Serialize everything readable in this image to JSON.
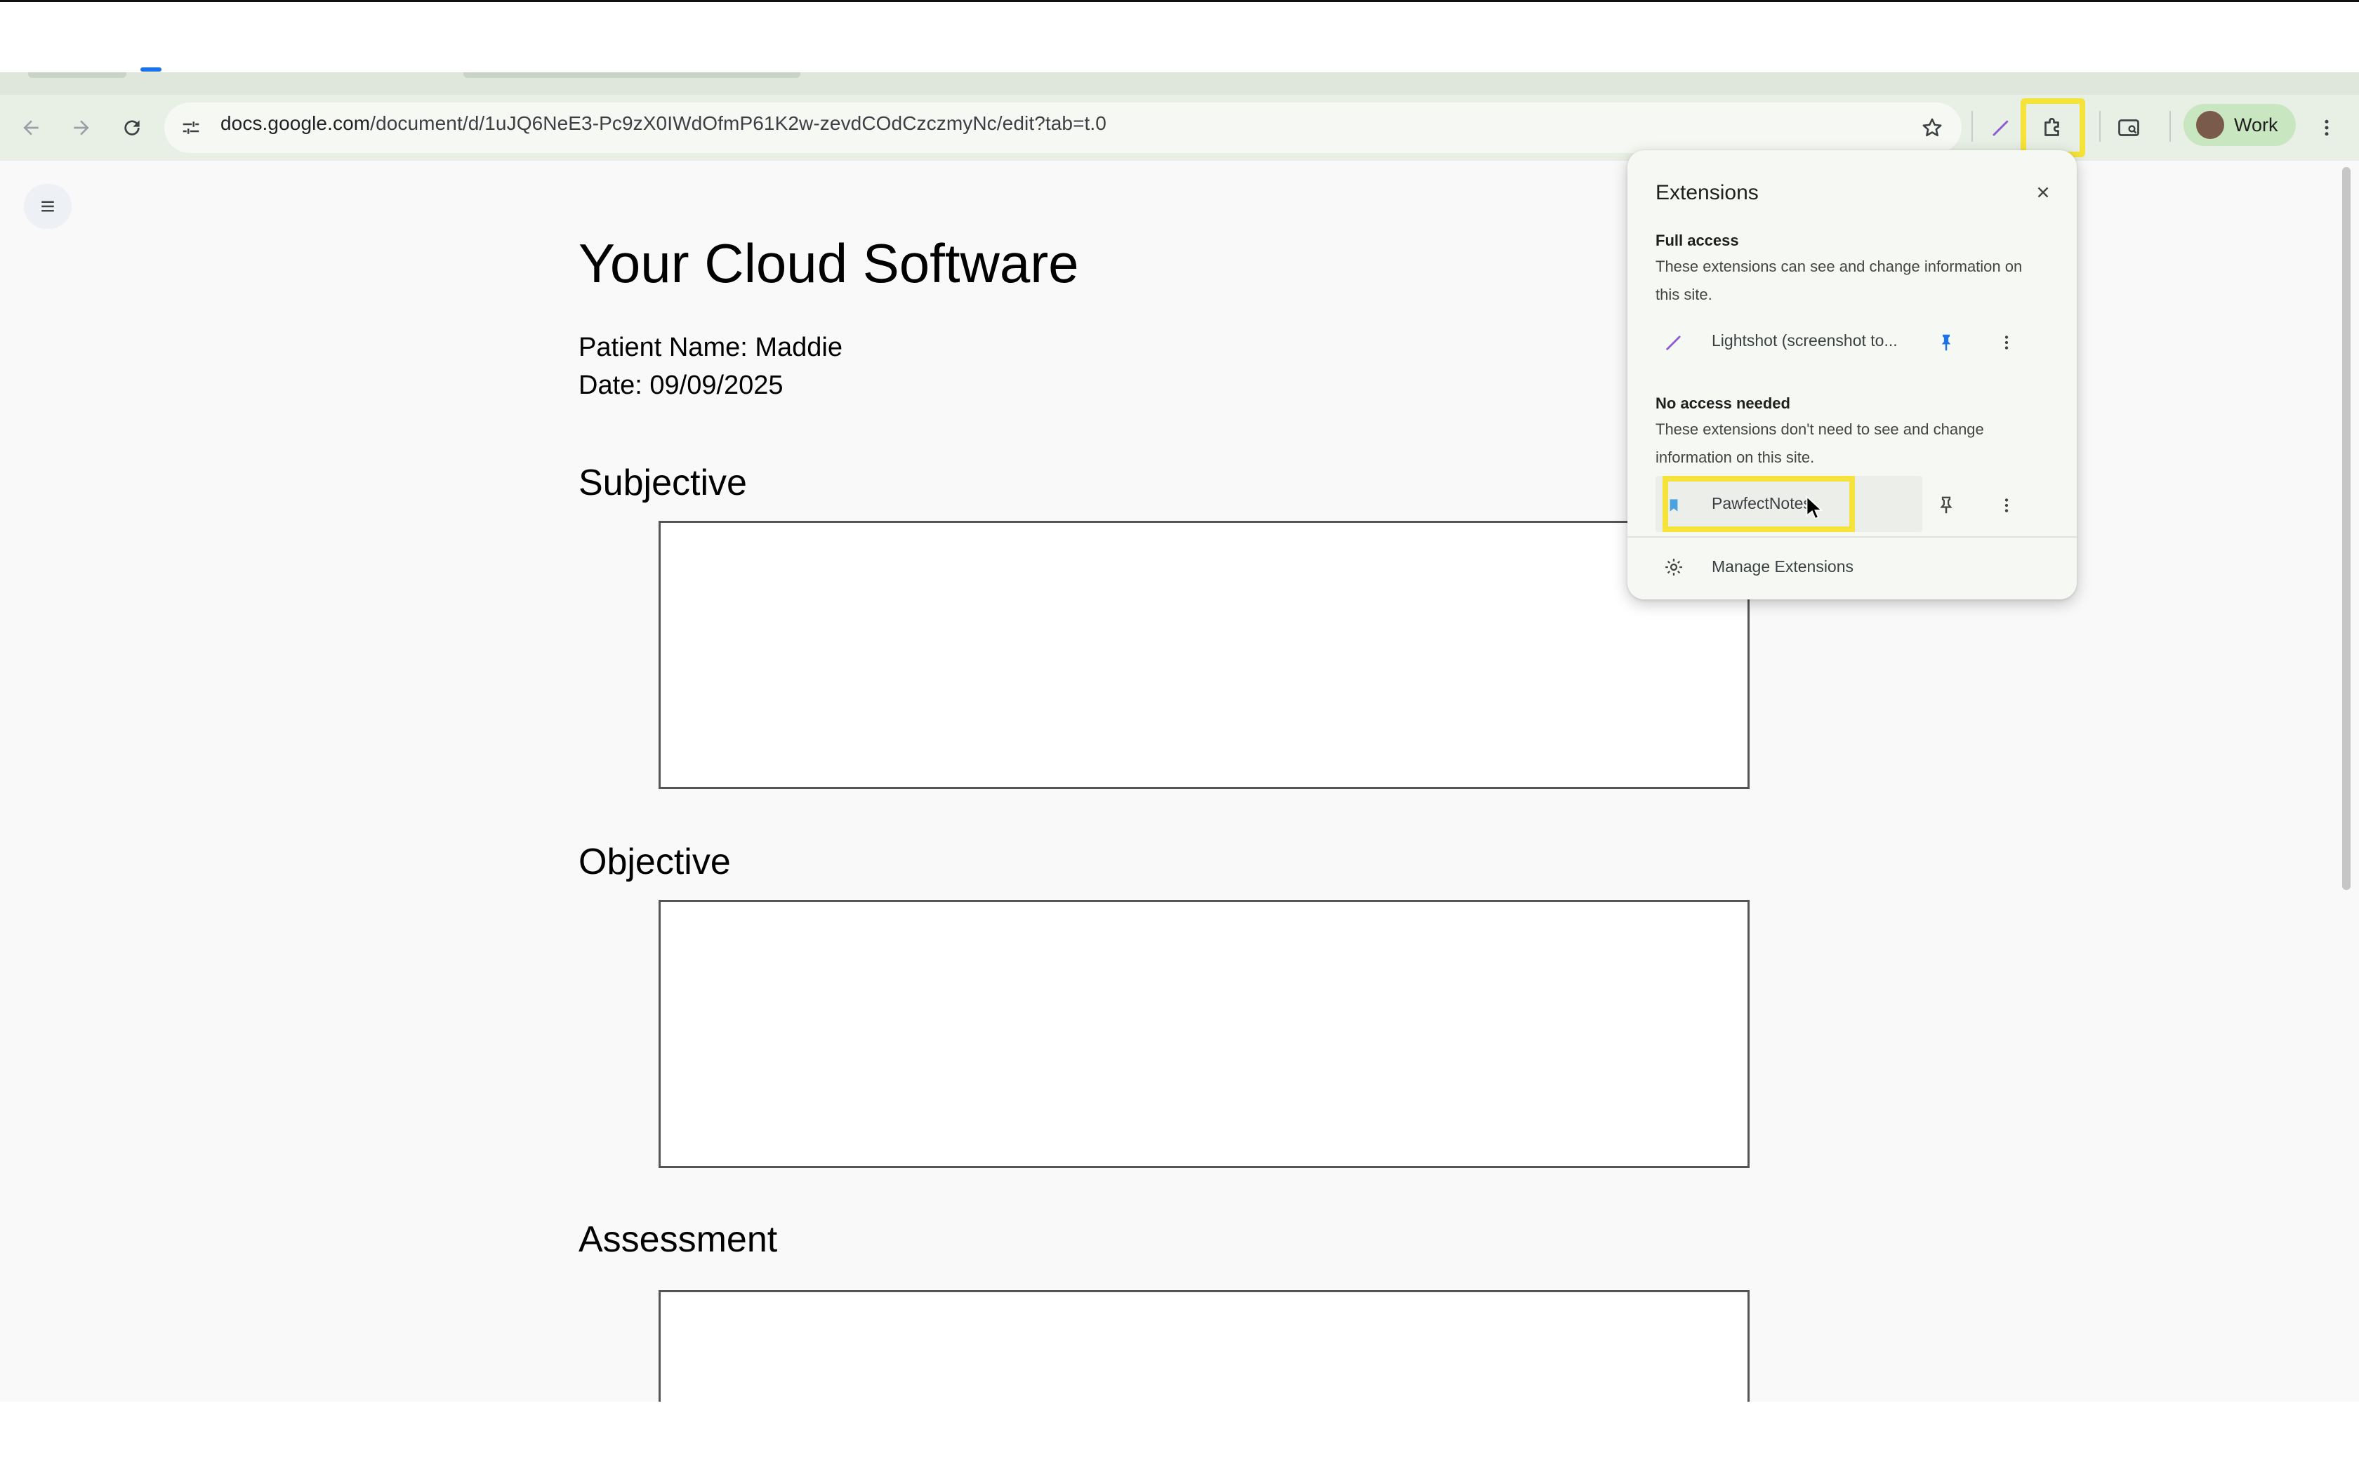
{
  "browser": {
    "url_host": "docs.google.com",
    "url_path": "/document/d/1uJQ6NeE3-Pc9zX0IWdOfmP61K2w-zevdCOdCzczmyNc/edit?tab=t.0",
    "profile_label": "Work",
    "icons": {
      "back": "arrow-left-icon",
      "forward": "arrow-right-icon",
      "reload": "reload-icon",
      "site_info": "tune-icon",
      "bookmark": "star-icon",
      "lightshot": "feather-icon",
      "extensions": "puzzle-icon",
      "tab_search": "tab-search-icon",
      "menu": "kebab-icon"
    },
    "highlight_color": "#f5e33b"
  },
  "document": {
    "title": "Your Cloud Software",
    "patient_name": "Patient Name: Maddie",
    "date": "Date: 09/09/2025",
    "sections": [
      {
        "heading": "Subjective"
      },
      {
        "heading": "Objective"
      },
      {
        "heading": "Assessment"
      }
    ]
  },
  "extensions_popup": {
    "title": "Extensions",
    "full_access": {
      "title": "Full access",
      "description": "These extensions can see and change information on this site."
    },
    "no_access": {
      "title": "No access needed",
      "description": "These extensions don't need to see and change information on this site."
    },
    "items": [
      {
        "name": "Lightshot (screenshot to...",
        "pinned": true
      },
      {
        "name": "PawfectNotes",
        "pinned": false
      }
    ],
    "manage_label": "Manage Extensions"
  }
}
